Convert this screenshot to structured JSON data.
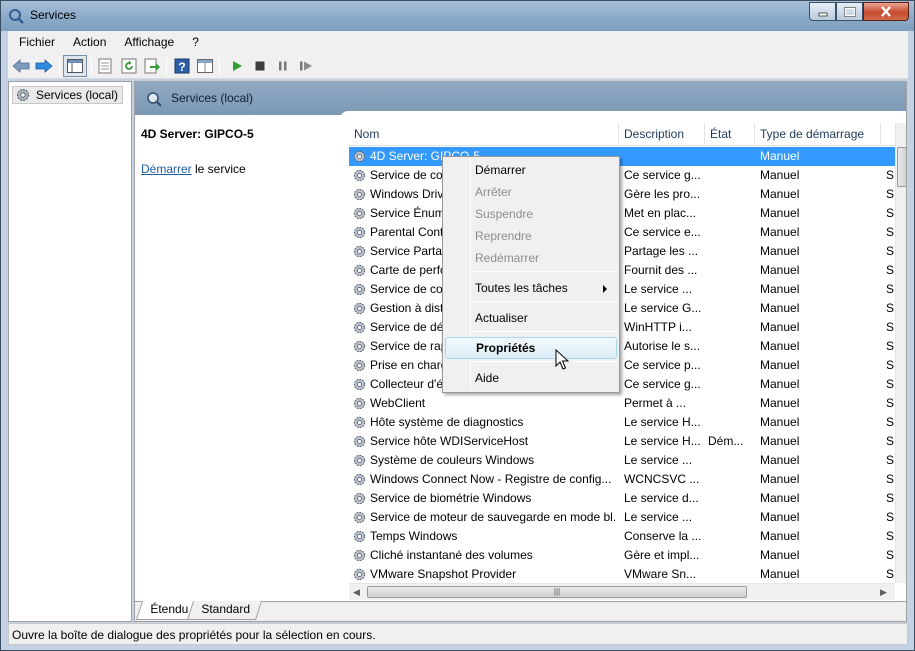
{
  "window": {
    "title": "Services"
  },
  "menubar": {
    "items": [
      "Fichier",
      "Action",
      "Affichage",
      "?"
    ]
  },
  "toolbar": {
    "icons": [
      "back-arrow-icon",
      "forward-arrow-icon",
      "show-hide-tree-icon",
      "properties-sheet-icon",
      "refresh-icon",
      "export-list-icon",
      "help-icon",
      "console-view-icon",
      "start-service-icon",
      "stop-service-icon",
      "pause-service-icon",
      "restart-service-icon"
    ]
  },
  "tree": {
    "root_label": "Services (local)"
  },
  "content": {
    "header": "Services (local)",
    "extended": {
      "service_name": "4D Server: GIPCO-5",
      "start_link": "Démarrer",
      "start_suffix": " le service"
    }
  },
  "list": {
    "columns": [
      "Nom",
      "Description",
      "État",
      "Type de démarrage"
    ],
    "rows": [
      {
        "name": "4D Server: GIPCO-5",
        "desc": "",
        "etat": "",
        "type": "Manuel",
        "more": "",
        "selected": true
      },
      {
        "name": "Service de co",
        "desc": "Ce service g...",
        "etat": "",
        "type": "Manuel",
        "more": "S"
      },
      {
        "name": "Windows Driv",
        "desc": "Gère les pro...",
        "etat": "",
        "type": "Manuel",
        "more": "S"
      },
      {
        "name": "Service Énum",
        "desc": "Met en plac...",
        "etat": "",
        "type": "Manuel",
        "more": "S"
      },
      {
        "name": "Parental Cont",
        "desc": "Ce service e...",
        "etat": "",
        "type": "Manuel",
        "more": "S"
      },
      {
        "name": "Service Partag",
        "desc": "Partage les ...",
        "etat": "",
        "type": "Manuel",
        "more": "S"
      },
      {
        "name": "Carte de perfo",
        "desc": "Fournit des ...",
        "etat": "",
        "type": "Manuel",
        "more": "S"
      },
      {
        "name": "Service de co",
        "desc": "Le service ...",
        "etat": "",
        "type": "Manuel",
        "more": "S"
      },
      {
        "name": "Gestion à dist",
        "desc": "Le service G...",
        "etat": "",
        "type": "Manuel",
        "more": "S"
      },
      {
        "name": "Service de dé",
        "desc": "WinHTTP i...",
        "etat": "",
        "type": "Manuel",
        "more": "S"
      },
      {
        "name": "Service de rap",
        "desc": "Autorise le s...",
        "etat": "",
        "type": "Manuel",
        "more": "S"
      },
      {
        "name": "Prise en charg",
        "desc": "Ce service p...",
        "etat": "",
        "type": "Manuel",
        "more": "S"
      },
      {
        "name": "Collecteur d'é",
        "desc": "Ce service g...",
        "etat": "",
        "type": "Manuel",
        "more": "S"
      },
      {
        "name": "WebClient",
        "desc": "Permet à ...",
        "etat": "",
        "type": "Manuel",
        "more": "S"
      },
      {
        "name": "Hôte système de diagnostics",
        "desc": "Le service H...",
        "etat": "",
        "type": "Manuel",
        "more": "S"
      },
      {
        "name": "Service hôte WDIServiceHost",
        "desc": "Le service H...",
        "etat": "Dém...",
        "type": "Manuel",
        "more": "S"
      },
      {
        "name": "Système de couleurs Windows",
        "desc": "Le service ...",
        "etat": "",
        "type": "Manuel",
        "more": "S"
      },
      {
        "name": "Windows Connect Now - Registre de config...",
        "desc": "WCNCSVC ...",
        "etat": "",
        "type": "Manuel",
        "more": "S"
      },
      {
        "name": "Service de biométrie Windows",
        "desc": "Le service d...",
        "etat": "",
        "type": "Manuel",
        "more": "S"
      },
      {
        "name": "Service de moteur de sauvegarde en mode bl...",
        "desc": "Le service ...",
        "etat": "",
        "type": "Manuel",
        "more": "S"
      },
      {
        "name": "Temps Windows",
        "desc": "Conserve la ...",
        "etat": "",
        "type": "Manuel",
        "more": "S"
      },
      {
        "name": "Cliché instantané des volumes",
        "desc": "Gère et impl...",
        "etat": "",
        "type": "Manuel",
        "more": "S"
      },
      {
        "name": "VMware Snapshot Provider",
        "desc": "VMware Sn...",
        "etat": "",
        "type": "Manuel",
        "more": "S"
      }
    ]
  },
  "tabs": [
    "Étendu",
    "Standard"
  ],
  "context_menu": {
    "items": [
      {
        "label": "Démarrer",
        "state": "enabled"
      },
      {
        "label": "Arrêter",
        "state": "disabled"
      },
      {
        "label": "Suspendre",
        "state": "disabled"
      },
      {
        "label": "Reprendre",
        "state": "disabled"
      },
      {
        "label": "Redémarrer",
        "state": "disabled"
      },
      {
        "label": "Toutes les tâches",
        "state": "submenu"
      },
      {
        "label": "Actualiser",
        "state": "enabled"
      },
      {
        "label": "Propriétés",
        "state": "default-hover"
      },
      {
        "label": "Aide",
        "state": "enabled"
      }
    ]
  },
  "statusbar": {
    "text": "Ouvre la boîte de dialogue des propriétés pour la sélection en cours."
  },
  "colors": {
    "selection": "#3399ff",
    "header_band": "#8fa9c2",
    "link": "#1f5aa7"
  }
}
